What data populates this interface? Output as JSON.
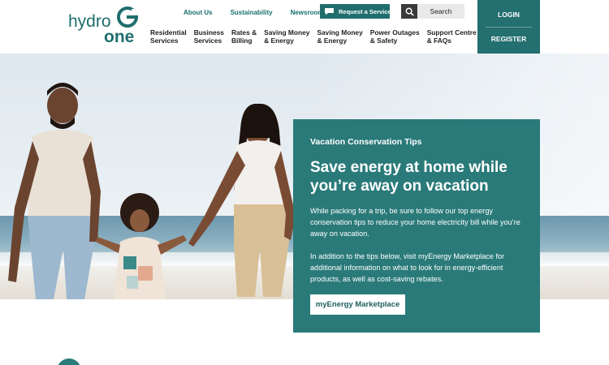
{
  "brand": {
    "name_top": "hydro",
    "name_bottom": "one",
    "accent": "#1f6e6d"
  },
  "utility_nav": [
    {
      "label": "About Us"
    },
    {
      "label": "Sustainability"
    },
    {
      "label": "Newsroom"
    }
  ],
  "request_service": {
    "label": "Request a Service",
    "icon": "chat-icon"
  },
  "search": {
    "label": "Search",
    "icon": "search-icon"
  },
  "main_nav": [
    {
      "line1": "Residential",
      "line2": "Services"
    },
    {
      "line1": "Business",
      "line2": "Services"
    },
    {
      "line1": "Rates &",
      "line2": "Billing"
    },
    {
      "line1": "Saving Money",
      "line2": "& Energy"
    },
    {
      "line1": "Saving Money",
      "line2": "& Energy"
    },
    {
      "line1": "Power Outages",
      "line2": "& Safety"
    },
    {
      "line1": "Support Centre",
      "line2": "& FAQs"
    }
  ],
  "auth": {
    "login": "LOGIN",
    "register": "REGISTER"
  },
  "hero_card": {
    "eyebrow": "Vacation Conservation Tips",
    "title": "Save energy at home while you’re away on vacation",
    "paragraph1": "While packing for a trip, be sure to follow our top energy conservation tips to reduce your home electricity bill while you’re away on vacation.",
    "paragraph2": "In addition to the tips below, visit myEnergy Marketplace for additional information on what to look for in energy-efficient products, as well as cost-saving rebates.",
    "cta_label": "myEnergy Marketplace"
  },
  "colors": {
    "teal": "#2b7a7a",
    "teal_dark": "#1f6e6d",
    "white": "#ffffff"
  }
}
